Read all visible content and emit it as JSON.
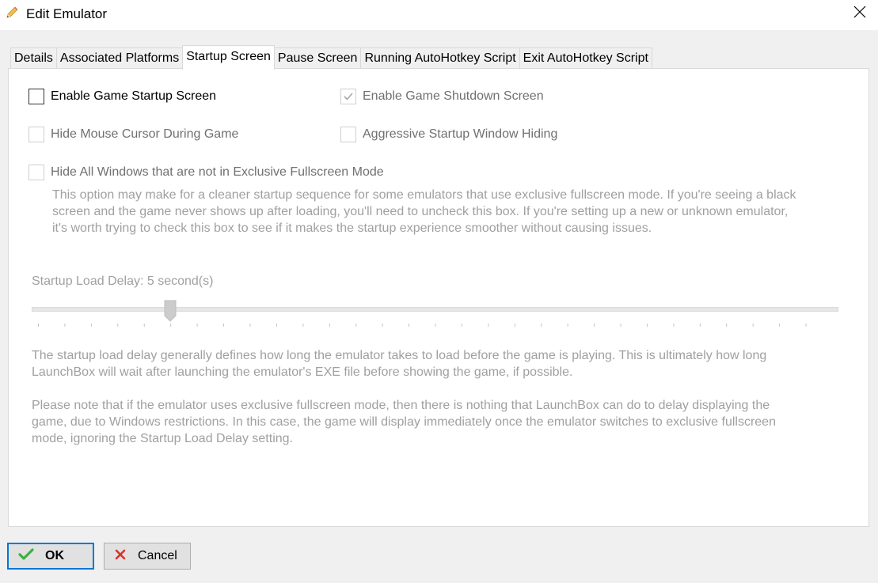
{
  "window": {
    "title": "Edit Emulator",
    "icon": "pencil-icon",
    "close_icon": "close-icon"
  },
  "tabs": [
    {
      "label": "Details"
    },
    {
      "label": "Associated Platforms"
    },
    {
      "label": "Startup Screen",
      "active": true
    },
    {
      "label": "Pause Screen"
    },
    {
      "label": "Running AutoHotkey Script"
    },
    {
      "label": "Exit AutoHotkey Script"
    }
  ],
  "startup": {
    "enable_startup": {
      "label": "Enable Game Startup Screen",
      "checked": false,
      "enabled": true
    },
    "enable_shutdown": {
      "label": "Enable Game Shutdown Screen",
      "checked": true,
      "enabled": false
    },
    "hide_mouse": {
      "label": "Hide Mouse Cursor During Game",
      "checked": false,
      "enabled": false
    },
    "aggressive_hiding": {
      "label": "Aggressive Startup Window Hiding",
      "checked": false,
      "enabled": false
    },
    "hide_windows": {
      "label": "Hide All Windows that are not in Exclusive Fullscreen Mode",
      "checked": false,
      "enabled": false
    },
    "hide_windows_hint": [
      "This option may make for a cleaner startup sequence for some emulators that use exclusive fullscreen mode. If you're seeing a black",
      "screen and the game never shows up after loading, you'll need to uncheck this box. If you're setting up a new or unknown emulator,",
      "it's worth trying to check this box to see if it makes the startup experience smoother without causing issues."
    ],
    "delay_label": "Startup Load Delay: 5 second(s)",
    "delay_value": 5,
    "delay_range": [
      0,
      30
    ],
    "delay_hint_1": [
      "The startup load delay generally defines how long the emulator takes to load before the game is playing. This is ultimately how long",
      "LaunchBox will wait after launching the emulator's EXE file before showing the game, if possible."
    ],
    "delay_hint_2": [
      "Please note that if the emulator uses exclusive fullscreen mode, then there is nothing that LaunchBox can do to delay displaying the",
      "game, due to Windows restrictions. In this case, the game will display immediately once the emulator switches to exclusive fullscreen",
      "mode, ignoring the Startup Load Delay setting."
    ]
  },
  "buttons": {
    "ok": {
      "label": "OK",
      "icon": "checkmark-icon",
      "icon_color": "#3cb043"
    },
    "cancel": {
      "label": "Cancel",
      "icon": "x-icon",
      "icon_color": "#e0302a"
    }
  },
  "colors": {
    "accent": "#0078d7",
    "disabled_text": "#a0a0a0"
  }
}
